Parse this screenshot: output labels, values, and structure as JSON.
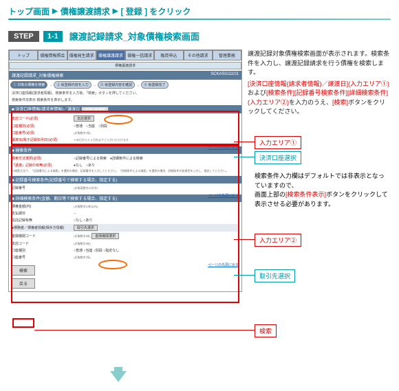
{
  "breadcrumb": {
    "a": "トップ画面",
    "b": "債権譲渡請求",
    "c": "[ 登録 ] をクリック"
  },
  "step": {
    "label": "STEP",
    "num": "1-1",
    "title": "譲渡記録請求_対象債権検索画面"
  },
  "tabs": [
    "トップ",
    "債権情報照会",
    "債権発生請求",
    "債権譲渡請求",
    "債権一括請求",
    "融資申込",
    "その他請求",
    "管理業務"
  ],
  "subtabs": [
    "債権譲渡請求"
  ],
  "panel_header": {
    "title": "譲渡記録請求_対象債権検索",
    "code": "SCKASG11101"
  },
  "wizard": [
    "① 対象の債権を検索",
    "② 仮登録内容を入力",
    "③ 仮登録内容を確認",
    "④ 仮登録完了"
  ],
  "note_top": "決済口座情報(請求者情報)、検索条件を入力後、「検索」ボタンを押してください。",
  "note_hide": "検索条件非表示 検索条件を表示します。",
  "sec1_title": "■ 決済口座情報(請求者情報)／譲渡日",
  "sec1": {
    "btn_account": "決済口座選択",
    "r1l": "支店コード(必須)",
    "r1btn": "支店選択",
    "r2l": "口座種別(必須)",
    "r2v": "○普通　○当座　○別段",
    "r3l": "口座番号(必須)",
    "r3n": "(半角数字7桁)",
    "r4l": "譲渡日(電子記録年月日)(必須)",
    "r4n": "※本日から１ヶ月先までご入力いただけます"
  },
  "sec2_title": "■ 検索条件",
  "sec2": {
    "r1l": "検索方法選択(必須)",
    "r1v": "○記録番号による検索　●詳細条件による検索",
    "r2l": "「譲渡」記録の有無(必須)",
    "r2v": "●なし　○あり",
    "r2n": "※検索方法で、「記録番号による検索」を選択の場合、記録番号を入力してください。「詳細条件による検索」を選択の場合、詳細条件の各項目を入力し、指定してください。"
  },
  "sec3_title": "■ 記録番号検索条件(記録番号で検索する場合、指定する)",
  "sec3_r1l": "記録番号",
  "sec3_r1n": "(半角英数字20文字)",
  "sec4_title": "■ 詳細検索条件(金額、期日等で検索する場合、指定する)",
  "link_top": "ページの先頭に戻る",
  "sec4": {
    "r1l": "債権金額(円)",
    "r1n": "(半角数字10桁以内)",
    "r2l": "支払期日",
    "r2n": "～",
    "r3l": "信託記録有無",
    "r3v": "○なし ○あり",
    "grp": "●債務者／債権者情報(相手方情報)",
    "btn_tori": "取引先選択",
    "g1l": "金融機関コード",
    "g1n": "(半角数字4桁)",
    "g1btn": "金融機関選択",
    "g2l": "支店コード",
    "g2n": "(半角数字3桁)",
    "g3l": "口座種別",
    "g3v": "○普通 ○当座 ○別段 ○指定なし",
    "g4l": "口座番号",
    "g4n": "(半角数字7桁)"
  },
  "btn_search": "検索",
  "btn_back": "戻る",
  "desc": {
    "p1a": "譲渡記録対象債権検索画面が表示されます。検索条件を入力し、譲渡記録請求を行う債権を検索します。",
    "p2a": "[決済口座情報(請求者情報)／譲渡日](入力エリア①)",
    "p2b": "および",
    "p2c": "[検索条件][記録番号検索条件][詳細検索条件](入力エリア②)",
    "p2d": "を入力のうえ、",
    "p2e": "[検索]",
    "p2f": "ボタンをクリックしてください。",
    "p3a": "検索条件入力欄はデフォルトでは非表示となっていますので、",
    "p3b": "画面上部の",
    "p3c": "[検索条件表示]",
    "p3d": "ボタンをクリックして表示させる必要があります。"
  },
  "callouts": {
    "c1": "入力エリア①",
    "c2": "決済口座選択",
    "c3": "入力エリア②",
    "c4": "取引先選択",
    "c5": "検索"
  }
}
